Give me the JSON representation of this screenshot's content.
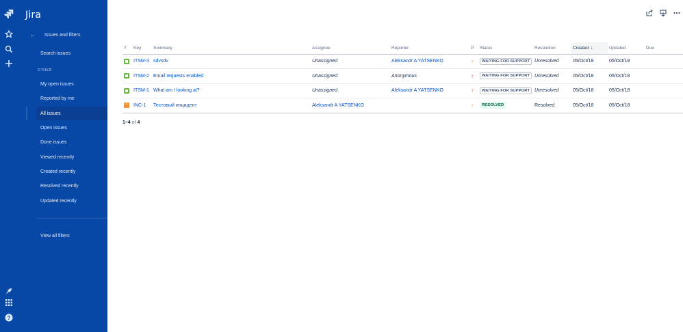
{
  "app": {
    "title": "Jira"
  },
  "rail": {
    "icons": [
      "jira-logo-icon",
      "star-icon",
      "search-icon",
      "plus-icon",
      "rocket-icon",
      "app-switcher-icon",
      "help-icon"
    ]
  },
  "sidebar": {
    "back_label": "Issues and filters",
    "search_label": "Search issues",
    "section_heading": "OTHER",
    "items": [
      {
        "label": "My open issues"
      },
      {
        "label": "Reported by me"
      },
      {
        "label": "All issues"
      },
      {
        "label": "Open issues"
      },
      {
        "label": "Done issues"
      },
      {
        "label": "Viewed recently"
      },
      {
        "label": "Created recently"
      },
      {
        "label": "Resolved recently"
      },
      {
        "label": "Updated recently"
      }
    ],
    "active_item": "All issues",
    "view_all_filters": "View all filters"
  },
  "toolbar": {
    "icons": [
      "share-icon",
      "export-icon",
      "more-icon"
    ]
  },
  "table": {
    "headers": {
      "t": "T",
      "key": "Key",
      "summary": "Summary",
      "assignee": "Assignee",
      "reporter": "Reporter",
      "p": "P",
      "status": "Status",
      "resolution": "Resolution",
      "created": "Created",
      "updated": "Updated",
      "due": "Due"
    },
    "sorted_by": "Created",
    "rows": [
      {
        "type": "service-request",
        "key": "ITSM-3",
        "summary": "sdvsdv",
        "assignee": "Unassigned",
        "reporter": "Aleksandr A YATSENKO",
        "priority": "medium",
        "status": "WAITING FOR SUPPORT",
        "resolution": "Unresolved",
        "created": "05/Oct/18",
        "updated": "05/Oct/18",
        "due": ""
      },
      {
        "type": "service-request",
        "key": "ITSM-2",
        "summary": "Email requests enabled",
        "assignee": "Unassigned",
        "reporter": "Anonymous",
        "priority": "high",
        "status": "WAITING FOR SUPPORT",
        "resolution": "Unresolved",
        "created": "05/Oct/18",
        "updated": "05/Oct/18",
        "due": ""
      },
      {
        "type": "service-request",
        "key": "ITSM-1",
        "summary": "What am I looking at?",
        "assignee": "Unassigned",
        "reporter": "Aleksandr A YATSENKO",
        "priority": "high",
        "status": "WAITING FOR SUPPORT",
        "resolution": "Unresolved",
        "created": "05/Oct/18",
        "updated": "05/Oct/18",
        "due": ""
      },
      {
        "type": "incident",
        "key": "INC-1",
        "summary": "Тестовый инцидент",
        "assignee": "Aleksandr A YATSENKO",
        "priority": "medium",
        "status": "RESOLVED",
        "resolution": "Resolved",
        "created": "05/Oct/18",
        "updated": "05/Oct/18",
        "due": ""
      }
    ]
  },
  "pagination": {
    "range": "1–4",
    "of": "of",
    "total": "4"
  },
  "colors": {
    "sidebar": "#0747a6",
    "link": "#0052cc",
    "priority_high": "#d04437",
    "priority_medium": "#f79232",
    "resolved_bg": "#e3fcef"
  }
}
